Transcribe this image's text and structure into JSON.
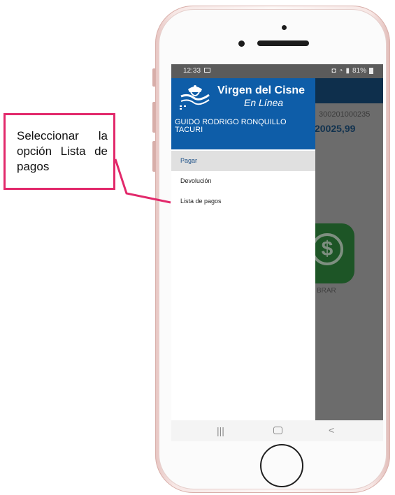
{
  "status_bar": {
    "time": "12:33",
    "battery": "81%"
  },
  "background_app": {
    "account_number": "300201000235",
    "balance": "20025,99",
    "cobrar_label": "BRAR"
  },
  "drawer": {
    "brand_name": "Virgen del Cisne",
    "brand_subtitle": "En Línea",
    "user_name": "GUIDO RODRIGO RONQUILLO TACURI",
    "menu_items": [
      {
        "label": "Pagar",
        "selected": true
      },
      {
        "label": "Devolución",
        "selected": false
      },
      {
        "label": "Lista de pagos",
        "selected": false
      }
    ]
  },
  "nav_bar": {
    "recent_icon": "recent-apps-icon",
    "home_icon": "home-icon",
    "back_icon": "back-icon"
  },
  "annotation": {
    "text": "Seleccionar la opción Lista de pagos"
  },
  "colors": {
    "drawer_header": "#0e5da8",
    "annotation_border": "#e2296b",
    "selected_item_bg": "#e0e0e0"
  }
}
